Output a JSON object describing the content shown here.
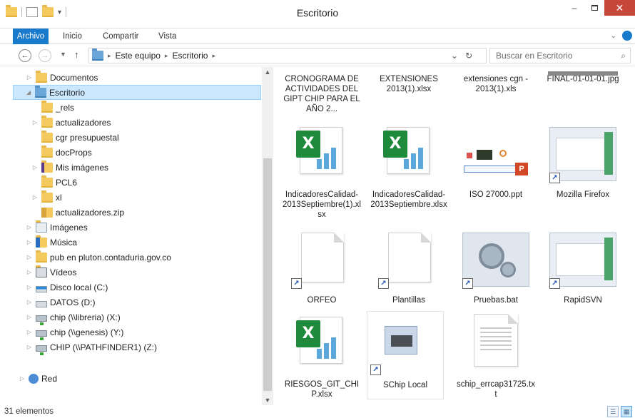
{
  "window": {
    "title": "Escritorio"
  },
  "ribbon": {
    "tabs": [
      "Archivo",
      "Inicio",
      "Compartir",
      "Vista"
    ]
  },
  "address": {
    "segments": [
      "Este equipo",
      "Escritorio"
    ],
    "search_placeholder": "Buscar en Escritorio"
  },
  "nav": {
    "items": [
      {
        "label": "Documentos",
        "icon": "documents-folder-icon"
      },
      {
        "label": "Escritorio",
        "icon": "desktop-folder-icon"
      },
      {
        "label": "_rels",
        "icon": "folder-icon"
      },
      {
        "label": "actualizadores",
        "icon": "folder-icon"
      },
      {
        "label": "cgr presupuestal",
        "icon": "folder-icon"
      },
      {
        "label": "docProps",
        "icon": "folder-icon"
      },
      {
        "label": "Mis imágenes",
        "icon": "pictures-folder-icon"
      },
      {
        "label": "PCL6",
        "icon": "folder-icon"
      },
      {
        "label": "xl",
        "icon": "folder-icon"
      },
      {
        "label": "actualizadores.zip",
        "icon": "zip-icon"
      },
      {
        "label": "Imágenes",
        "icon": "pictures-library-icon"
      },
      {
        "label": "Música",
        "icon": "music-library-icon"
      },
      {
        "label": "pub en pluton.contaduria.gov.co",
        "icon": "network-folder-icon"
      },
      {
        "label": "Vídeos",
        "icon": "videos-library-icon"
      },
      {
        "label": "Disco local (C:)",
        "icon": "windows-drive-icon"
      },
      {
        "label": "DATOS (D:)",
        "icon": "drive-icon"
      },
      {
        "label": "chip (\\\\libreria) (X:)",
        "icon": "network-drive-icon"
      },
      {
        "label": "chip (\\\\genesis) (Y:)",
        "icon": "network-drive-icon"
      },
      {
        "label": "CHIP (\\\\PATHFINDER1) (Z:)",
        "icon": "network-drive-icon"
      },
      {
        "label": "Red",
        "icon": "network-icon"
      }
    ]
  },
  "files": [
    {
      "label": "CRONOGRAMA DE ACTIVIDADES DEL GIPT CHIP PARA EL AÑO 2...",
      "icon": "document-icon"
    },
    {
      "label": "EXTENSIONES 2013(1).xlsx",
      "icon": "excel-icon"
    },
    {
      "label": "extensiones cgn - 2013(1).xls",
      "icon": "excel-icon"
    },
    {
      "label": "FINAL-01-01-01.jpg",
      "icon": "image-icon"
    },
    {
      "label": "IndicadoresCalidad-2013Septiembre(1).xlsx",
      "icon": "excel-icon"
    },
    {
      "label": "IndicadoresCalidad-2013Septiembre.xlsx",
      "icon": "excel-icon"
    },
    {
      "label": "ISO 27000.ppt",
      "icon": "powerpoint-icon"
    },
    {
      "label": "Mozilla Firefox",
      "icon": "firefox-shortcut-icon"
    },
    {
      "label": "ORFEO",
      "icon": "shortcut-icon"
    },
    {
      "label": "Plantillas",
      "icon": "shortcut-icon"
    },
    {
      "label": "Pruebas.bat",
      "icon": "batch-gears-icon"
    },
    {
      "label": "RapidSVN",
      "icon": "rapidsvn-shortcut-icon"
    },
    {
      "label": "RIESGOS_GIT_CHIP.xlsx",
      "icon": "excel-icon"
    },
    {
      "label": "SChip Local",
      "icon": "chip-shortcut-icon"
    },
    {
      "label": "schip_errcap31725.txt",
      "icon": "text-file-icon"
    }
  ],
  "status": {
    "count": "31 elementos"
  }
}
